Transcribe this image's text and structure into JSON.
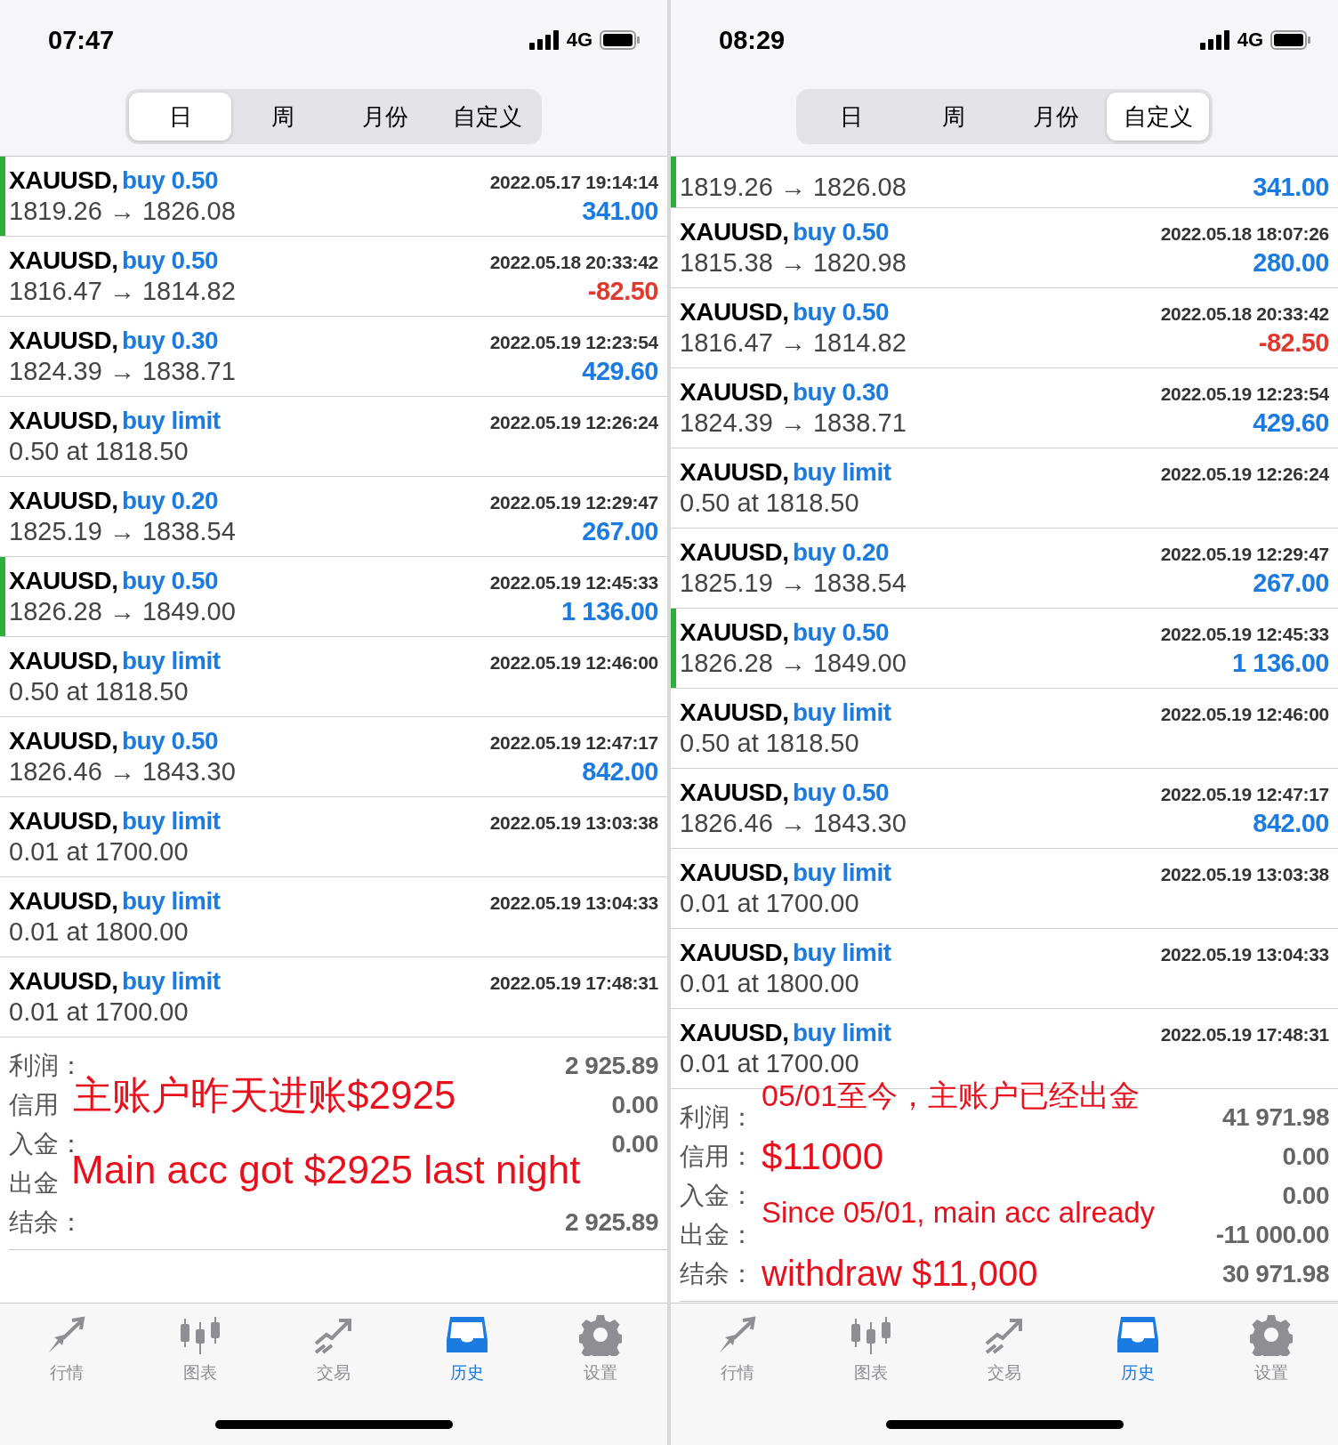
{
  "phones": [
    {
      "time": "07:47",
      "network": "4G",
      "tabs": [
        {
          "label": "日",
          "selected": true
        },
        {
          "label": "周",
          "selected": false
        },
        {
          "label": "月份",
          "selected": false
        },
        {
          "label": "自定义",
          "selected": false
        }
      ],
      "trades": [
        {
          "symbol": "XAUUSD,",
          "order": "buy 0.50",
          "time": "2022.05.17 19:14:14",
          "detail": "1819.26 → 1826.08",
          "profit": "341.00",
          "loss": false,
          "highlighted": true
        },
        {
          "symbol": "XAUUSD,",
          "order": "buy 0.50",
          "time": "2022.05.18 20:33:42",
          "detail": "1816.47 → 1814.82",
          "profit": "-82.50",
          "loss": true,
          "highlighted": false
        },
        {
          "symbol": "XAUUSD,",
          "order": "buy 0.30",
          "time": "2022.05.19 12:23:54",
          "detail": "1824.39 → 1838.71",
          "profit": "429.60",
          "loss": false,
          "highlighted": false
        },
        {
          "symbol": "XAUUSD,",
          "order": "buy limit",
          "time": "2022.05.19 12:26:24",
          "detail": "0.50 at 1818.50",
          "highlighted": false
        },
        {
          "symbol": "XAUUSD,",
          "order": "buy 0.20",
          "time": "2022.05.19 12:29:47",
          "detail": "1825.19 → 1838.54",
          "profit": "267.00",
          "loss": false,
          "highlighted": false
        },
        {
          "symbol": "XAUUSD,",
          "order": "buy 0.50",
          "time": "2022.05.19 12:45:33",
          "detail": "1826.28 → 1849.00",
          "profit": "1 136.00",
          "loss": false,
          "highlighted": true
        },
        {
          "symbol": "XAUUSD,",
          "order": "buy limit",
          "time": "2022.05.19 12:46:00",
          "detail": "0.50 at 1818.50",
          "highlighted": false
        },
        {
          "symbol": "XAUUSD,",
          "order": "buy 0.50",
          "time": "2022.05.19 12:47:17",
          "detail": "1826.46 → 1843.30",
          "profit": "842.00",
          "loss": false,
          "highlighted": false
        },
        {
          "symbol": "XAUUSD,",
          "order": "buy limit",
          "time": "2022.05.19 13:03:38",
          "detail": "0.01 at 1700.00",
          "highlighted": false
        },
        {
          "symbol": "XAUUSD,",
          "order": "buy limit",
          "time": "2022.05.19 13:04:33",
          "detail": "0.01 at 1800.00",
          "highlighted": false
        },
        {
          "symbol": "XAUUSD,",
          "order": "buy limit",
          "time": "2022.05.19 17:48:31",
          "detail": "0.01 at 1700.00",
          "highlighted": false
        }
      ],
      "summary": [
        {
          "label": "利润：",
          "value": "2 925.89"
        },
        {
          "label": "信用",
          "value": "0.00"
        },
        {
          "label": "入金：",
          "value": "0.00"
        },
        {
          "label": "出金"
        },
        {
          "label": "结余：",
          "value": "2 925.89"
        }
      ],
      "annotations": [
        "主账户昨天进账$2925",
        "Main acc got $2925 last night"
      ],
      "nav": [
        {
          "label": "行情",
          "selected": false
        },
        {
          "label": "图表",
          "selected": false
        },
        {
          "label": "交易",
          "selected": false
        },
        {
          "label": "历史",
          "selected": true
        },
        {
          "label": "设置",
          "selected": false
        }
      ]
    },
    {
      "time": "08:29",
      "network": "4G",
      "tabs": [
        {
          "label": "日",
          "selected": false
        },
        {
          "label": "周",
          "selected": false
        },
        {
          "label": "月份",
          "selected": false
        },
        {
          "label": "自定义",
          "selected": true
        }
      ],
      "trades": [
        {
          "detail": "1819.26 → 1826.08",
          "profit": "341.00",
          "loss": false,
          "highlighted": true
        },
        {
          "symbol": "XAUUSD,",
          "order": "buy 0.50",
          "time": "2022.05.18 18:07:26",
          "detail": "1815.38 → 1820.98",
          "profit": "280.00",
          "loss": false,
          "highlighted": false
        },
        {
          "symbol": "XAUUSD,",
          "order": "buy 0.50",
          "time": "2022.05.18 20:33:42",
          "detail": "1816.47 → 1814.82",
          "profit": "-82.50",
          "loss": true,
          "highlighted": false
        },
        {
          "symbol": "XAUUSD,",
          "order": "buy 0.30",
          "time": "2022.05.19 12:23:54",
          "detail": "1824.39 → 1838.71",
          "profit": "429.60",
          "loss": false,
          "highlighted": false
        },
        {
          "symbol": "XAUUSD,",
          "order": "buy limit",
          "time": "2022.05.19 12:26:24",
          "detail": "0.50 at 1818.50",
          "highlighted": false
        },
        {
          "symbol": "XAUUSD,",
          "order": "buy 0.20",
          "time": "2022.05.19 12:29:47",
          "detail": "1825.19 → 1838.54",
          "profit": "267.00",
          "loss": false,
          "highlighted": false
        },
        {
          "symbol": "XAUUSD,",
          "order": "buy 0.50",
          "time": "2022.05.19 12:45:33",
          "detail": "1826.28 → 1849.00",
          "profit": "1 136.00",
          "loss": false,
          "highlighted": true
        },
        {
          "symbol": "XAUUSD,",
          "order": "buy limit",
          "time": "2022.05.19 12:46:00",
          "detail": "0.50 at 1818.50",
          "highlighted": false
        },
        {
          "symbol": "XAUUSD,",
          "order": "buy 0.50",
          "time": "2022.05.19 12:47:17",
          "detail": "1826.46 → 1843.30",
          "profit": "842.00",
          "loss": false,
          "highlighted": false
        },
        {
          "symbol": "XAUUSD,",
          "order": "buy limit",
          "time": "2022.05.19 13:03:38",
          "detail": "0.01 at 1700.00",
          "highlighted": false
        },
        {
          "symbol": "XAUUSD,",
          "order": "buy limit",
          "time": "2022.05.19 13:04:33",
          "detail": "0.01 at 1800.00",
          "highlighted": false
        },
        {
          "symbol": "XAUUSD,",
          "order": "buy limit",
          "time": "2022.05.19 17:48:31",
          "detail": "0.01 at 1700.00",
          "highlighted": false
        }
      ],
      "summary": [
        {
          "label": "利润：",
          "value": "41 971.98"
        },
        {
          "label": "信用：",
          "value": "0.00"
        },
        {
          "label": "入金：",
          "value": "0.00"
        },
        {
          "label": "出金：",
          "value": "-11 000.00"
        },
        {
          "label": "结余：",
          "value": "30 971.98"
        }
      ],
      "annotations": [
        "05/01至今，主账户已经出金",
        "$11000",
        "Since 05/01, main acc already",
        "withdraw $11,000"
      ],
      "nav": [
        {
          "label": "行情",
          "selected": false
        },
        {
          "label": "图表",
          "selected": false
        },
        {
          "label": "交易",
          "selected": false
        },
        {
          "label": "历史",
          "selected": true
        },
        {
          "label": "设置",
          "selected": false
        }
      ]
    }
  ]
}
